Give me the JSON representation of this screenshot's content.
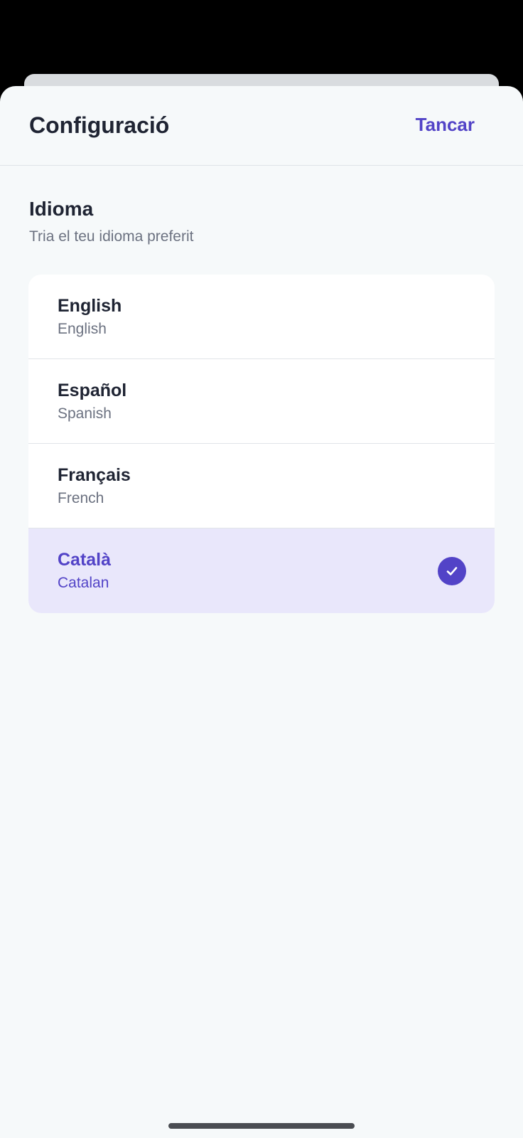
{
  "header": {
    "title": "Configuració",
    "close_label": "Tancar"
  },
  "section": {
    "title": "Idioma",
    "subtitle": "Tria el teu idioma preferit"
  },
  "languages": [
    {
      "name": "English",
      "subtitle": "English",
      "selected": false
    },
    {
      "name": "Español",
      "subtitle": "Spanish",
      "selected": false
    },
    {
      "name": "Français",
      "subtitle": "French",
      "selected": false
    },
    {
      "name": "Català",
      "subtitle": "Catalan",
      "selected": true
    }
  ],
  "icons": {
    "selected": "check-circle-icon"
  },
  "colors": {
    "accent": "#5243c7",
    "selected_background": "#e9e7fb",
    "text_primary": "#1f2433",
    "text_secondary": "#6b7180",
    "sheet_background": "#f6f9fa"
  }
}
